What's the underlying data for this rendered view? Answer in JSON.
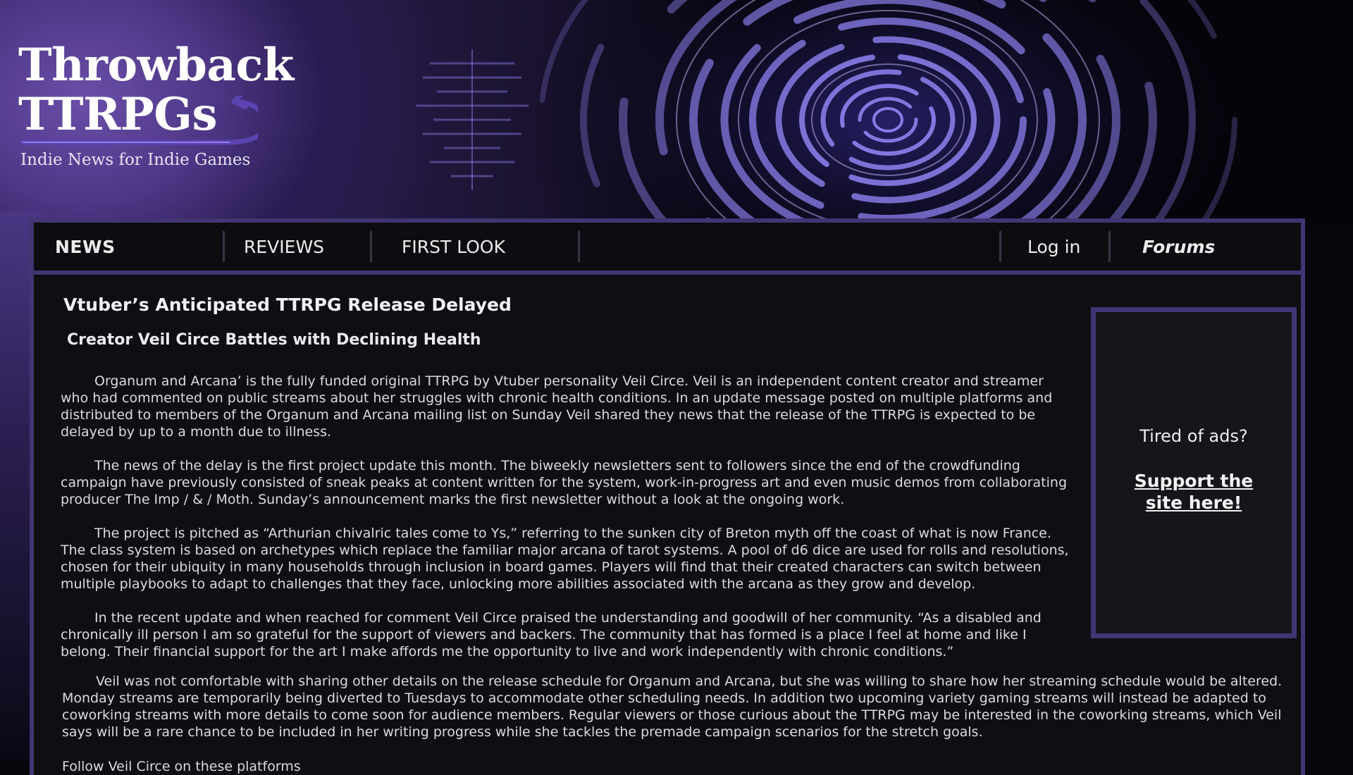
{
  "site": {
    "title_line1": "Throwback",
    "title_line2": "TTRPGs",
    "tagline": "Indie News for Indie Games"
  },
  "nav": {
    "news": "NEWS",
    "reviews": "REVIEWS",
    "first_look": "FIRST LOOK",
    "login": "Log in",
    "forums": "Forums"
  },
  "article": {
    "headline": "Vtuber’s Anticipated TTRPG Release Delayed",
    "subhead": "Creator Veil Circe Battles with Declining Health",
    "paragraphs": [
      "Organum and Arcana’ is the fully funded original TTRPG by Vtuber personality Veil Circe. Veil is an independent content creator and streamer who had commented on public streams about her struggles with chronic health conditions. In an update message posted on multiple platforms and distributed to members of the Organum and Arcana mailing list on Sunday Veil shared they news that the release of the TTRPG is expected to be delayed by up to a month due to illness.",
      "The news of the delay is the first project update this month. The biweekly newsletters sent to followers since the end of the crowdfunding campaign have previously consisted of sneak peaks at content written for the system, work-in-progress art and even music demos from collaborating producer The Imp / & / Moth. Sunday’s announcement marks the first newsletter without a look at the ongoing work.",
      "The project is pitched as “Arthurian chivalric tales come to Ys,” referring to the sunken city of Breton myth off the coast of what is now France. The class system is based on archetypes which replace the familiar major arcana of tarot systems. A pool of d6 dice are used for rolls and resolutions, chosen for their ubiquity in many households through inclusion in board games. Players will find that their created characters can switch between multiple playbooks to adapt to challenges that they face, unlocking more abilities associated with the arcana as they grow and develop.",
      "In the recent update and when reached for comment Veil Circe praised the understanding and goodwill of her community. “As a disabled and chronically ill person I am so grateful for the support of viewers and backers. The community that has formed is a place I feel at home and like I belong. Their financial support for the art I make affords me the opportunity to live and work independently with chronic conditions.”",
      "Veil was not comfortable with sharing other details on the release schedule for Organum and Arcana, but she was willing to share how her streaming schedule would be altered. Monday streams are temporarily being diverted to Tuesdays to accommodate other scheduling needs. In addition two upcoming variety gaming streams will instead be adapted to coworking streams with more details to come soon for audience members. Regular viewers or those curious about the TTRPG may be interested in the coworking streams, which Veil says will be a rare chance to be included in her writing progress while she tackles the premade campaign scenarios for the stretch goals."
    ],
    "follow": "Follow Veil Circe on these platforms"
  },
  "ad": {
    "question": "Tired of ads?",
    "link": "Support the site here!"
  },
  "colors": {
    "frame_border": "#413573",
    "nav_bg": "#0d0c10",
    "content_bg": "#0f0e13",
    "accent_purple": "#6a4ea8"
  }
}
